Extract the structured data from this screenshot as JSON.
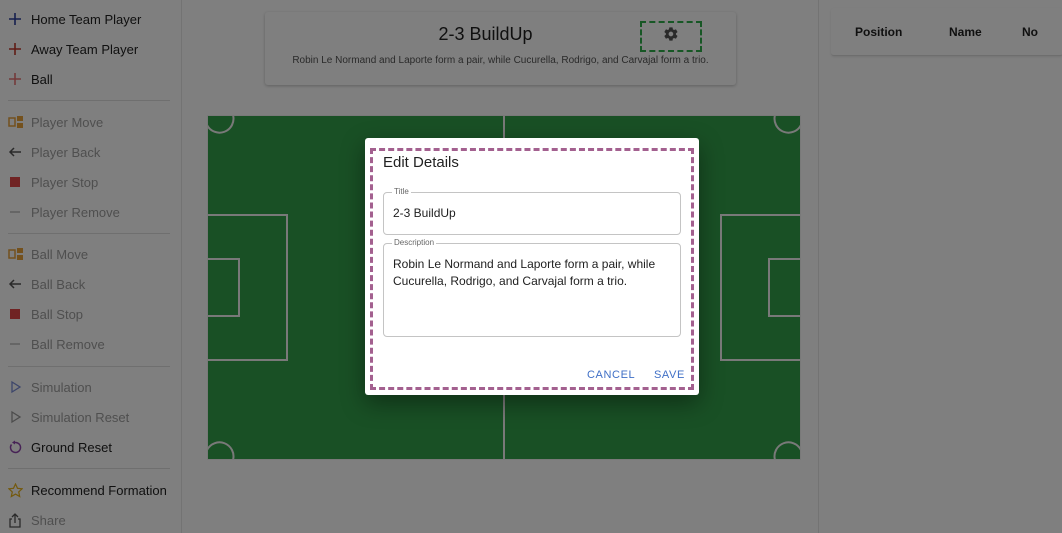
{
  "sidebar": {
    "players": [
      {
        "label": "Home Team Player",
        "icon": "plus-icon",
        "color": "#2c3e9c"
      },
      {
        "label": "Away Team Player",
        "icon": "plus-icon",
        "color": "#c0392b"
      },
      {
        "label": "Ball",
        "icon": "plus-icon",
        "color": "#e87474"
      }
    ],
    "player_actions": [
      {
        "label": "Player Move",
        "icon": "move-icon"
      },
      {
        "label": "Player Back",
        "icon": "arrow-left-icon"
      },
      {
        "label": "Player Stop",
        "icon": "stop-icon"
      },
      {
        "label": "Player Remove",
        "icon": "minus-icon"
      }
    ],
    "ball_actions": [
      {
        "label": "Ball Move",
        "icon": "move-icon"
      },
      {
        "label": "Ball Back",
        "icon": "arrow-left-icon"
      },
      {
        "label": "Ball Stop",
        "icon": "stop-icon"
      },
      {
        "label": "Ball Remove",
        "icon": "minus-icon"
      }
    ],
    "sim_actions": [
      {
        "label": "Simulation",
        "icon": "play-icon"
      },
      {
        "label": "Simulation Reset",
        "icon": "play-icon"
      },
      {
        "label": "Ground Reset",
        "icon": "reset-icon"
      }
    ],
    "extra_actions": [
      {
        "label": "Recommend Formation",
        "icon": "star-icon"
      },
      {
        "label": "Share",
        "icon": "share-icon"
      }
    ]
  },
  "title_card": {
    "title": "2-3 BuildUp",
    "description": "Robin Le Normand and Laporte form a pair, while Cucurella, Rodrigo, and Carvajal form a trio.",
    "settings_icon": "gear-icon"
  },
  "table": {
    "headers": [
      "Position",
      "Name",
      "No"
    ]
  },
  "dialog": {
    "title": "Edit Details",
    "title_field": {
      "label": "Title",
      "value": "2-3 BuildUp"
    },
    "description_field": {
      "label": "Description",
      "value": "Robin Le Normand and Laporte form a pair, while Cucurella, Rodrigo, and Carvajal form a trio."
    },
    "cancel_label": "CANCEL",
    "save_label": "SAVE"
  },
  "colors": {
    "pitch": "#32a14a",
    "accent_blue": "#3f6fc6",
    "dialog_outline": "#a3608f",
    "gear_outline": "#2eae4a"
  }
}
